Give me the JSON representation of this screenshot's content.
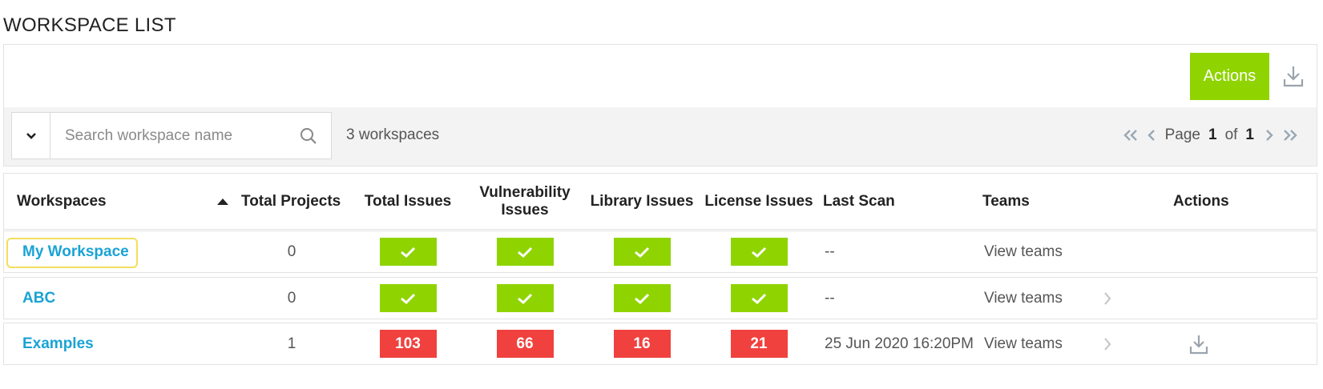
{
  "page": {
    "title": "WORKSPACE LIST"
  },
  "toolbar": {
    "actions_label": "Actions",
    "search_placeholder": "Search workspace name",
    "count_text": "3 workspaces"
  },
  "pager": {
    "page_label": "Page",
    "current": "1",
    "of_label": "of",
    "total": "1"
  },
  "table": {
    "headers": {
      "workspaces": "Workspaces",
      "total_projects": "Total Projects",
      "total_issues": "Total Issues",
      "vulnerability_line1": "Vulnerability",
      "vulnerability_line2": "Issues",
      "library_issues": "Library Issues",
      "license_issues": "License Issues",
      "last_scan": "Last Scan",
      "teams": "Teams",
      "actions": "Actions"
    },
    "rows": [
      {
        "name": "My Workspace",
        "projects": "0",
        "total": "",
        "vuln": "",
        "library": "",
        "license": "",
        "last_scan": "--",
        "teams": "View teams"
      },
      {
        "name": "ABC",
        "projects": "0",
        "total": "",
        "vuln": "",
        "library": "",
        "license": "",
        "last_scan": "--",
        "teams": "View teams"
      },
      {
        "name": "Examples",
        "projects": "1",
        "total": "103",
        "vuln": "66",
        "library": "16",
        "license": "21",
        "last_scan": "25 Jun 2020 16:20PM",
        "teams": "View teams"
      }
    ]
  },
  "colors": {
    "accent_green": "#8fd400",
    "issue_red": "#f0413e",
    "link_blue": "#1aa3d4",
    "focus_yellow": "#f2de5e"
  },
  "icons": [
    "download-icon",
    "chevron-down-icon",
    "search-icon",
    "first-page-icon",
    "prev-page-icon",
    "next-page-icon",
    "last-page-icon",
    "check-icon",
    "chevron-right-icon",
    "sort-up-icon"
  ]
}
